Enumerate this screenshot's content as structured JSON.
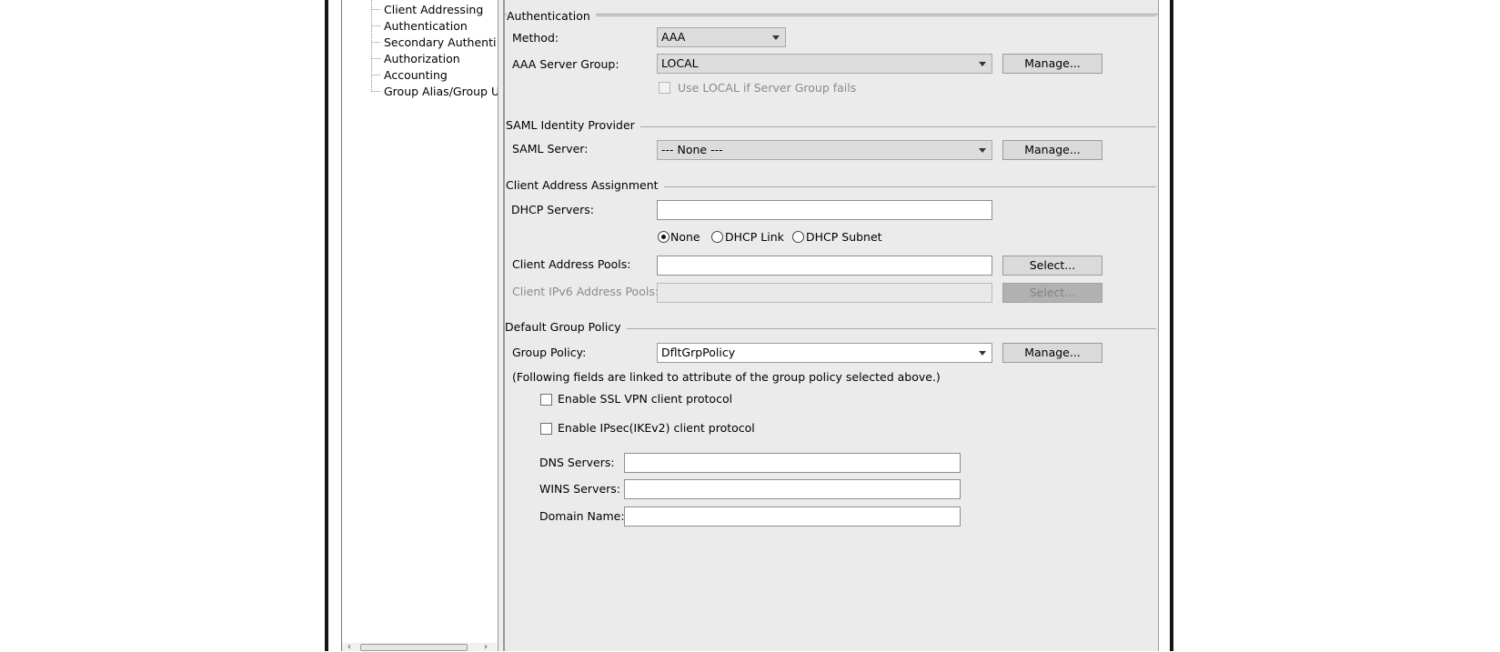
{
  "nav_tree": {
    "items": [
      {
        "label": "Client Addressing"
      },
      {
        "label": "Authentication"
      },
      {
        "label": "Secondary Authenticat"
      },
      {
        "label": "Authorization"
      },
      {
        "label": "Accounting"
      },
      {
        "label": "Group Alias/Group URL"
      }
    ],
    "scroll_left": "‹",
    "scroll_right": "›"
  },
  "authentication": {
    "title": "Authentication",
    "method_label": "Method:",
    "method_value": "AAA",
    "aaa_server_group_label": "AAA Server Group:",
    "aaa_server_group_value": "LOCAL",
    "manage_label": "Manage...",
    "use_local_label": "Use LOCAL if Server Group fails",
    "use_local_checked": false
  },
  "saml": {
    "title": "SAML Identity Provider",
    "server_label": "SAML Server:",
    "server_value": "--- None ---",
    "manage_label": "Manage..."
  },
  "client_address": {
    "title": "Client Address Assignment",
    "dhcp_label": "DHCP Servers:",
    "dhcp_value": "",
    "radio_options": [
      "None",
      "DHCP Link",
      "DHCP Subnet"
    ],
    "radio_selected": "None",
    "pools_label": "Client Address Pools:",
    "pools_value": "",
    "select_label": "Select...",
    "ipv6_pools_label": "Client IPv6 Address Pools:",
    "ipv6_pools_value": "",
    "ipv6_select_label": "Select..."
  },
  "group_policy": {
    "title": "Default Group Policy",
    "policy_label": "Group Policy:",
    "policy_value": "DfltGrpPolicy",
    "manage_label": "Manage...",
    "note": "(Following fields are linked to attribute of the group policy selected above.)",
    "ssl_vpn_label": "Enable SSL VPN client protocol",
    "ssl_vpn_checked": false,
    "ipsec_label": "Enable IPsec(IKEv2) client protocol",
    "ipsec_checked": false,
    "dns_label": "DNS Servers:",
    "dns_value": "",
    "wins_label": "WINS Servers:",
    "wins_value": "",
    "domain_label": "Domain Name:",
    "domain_value": ""
  }
}
